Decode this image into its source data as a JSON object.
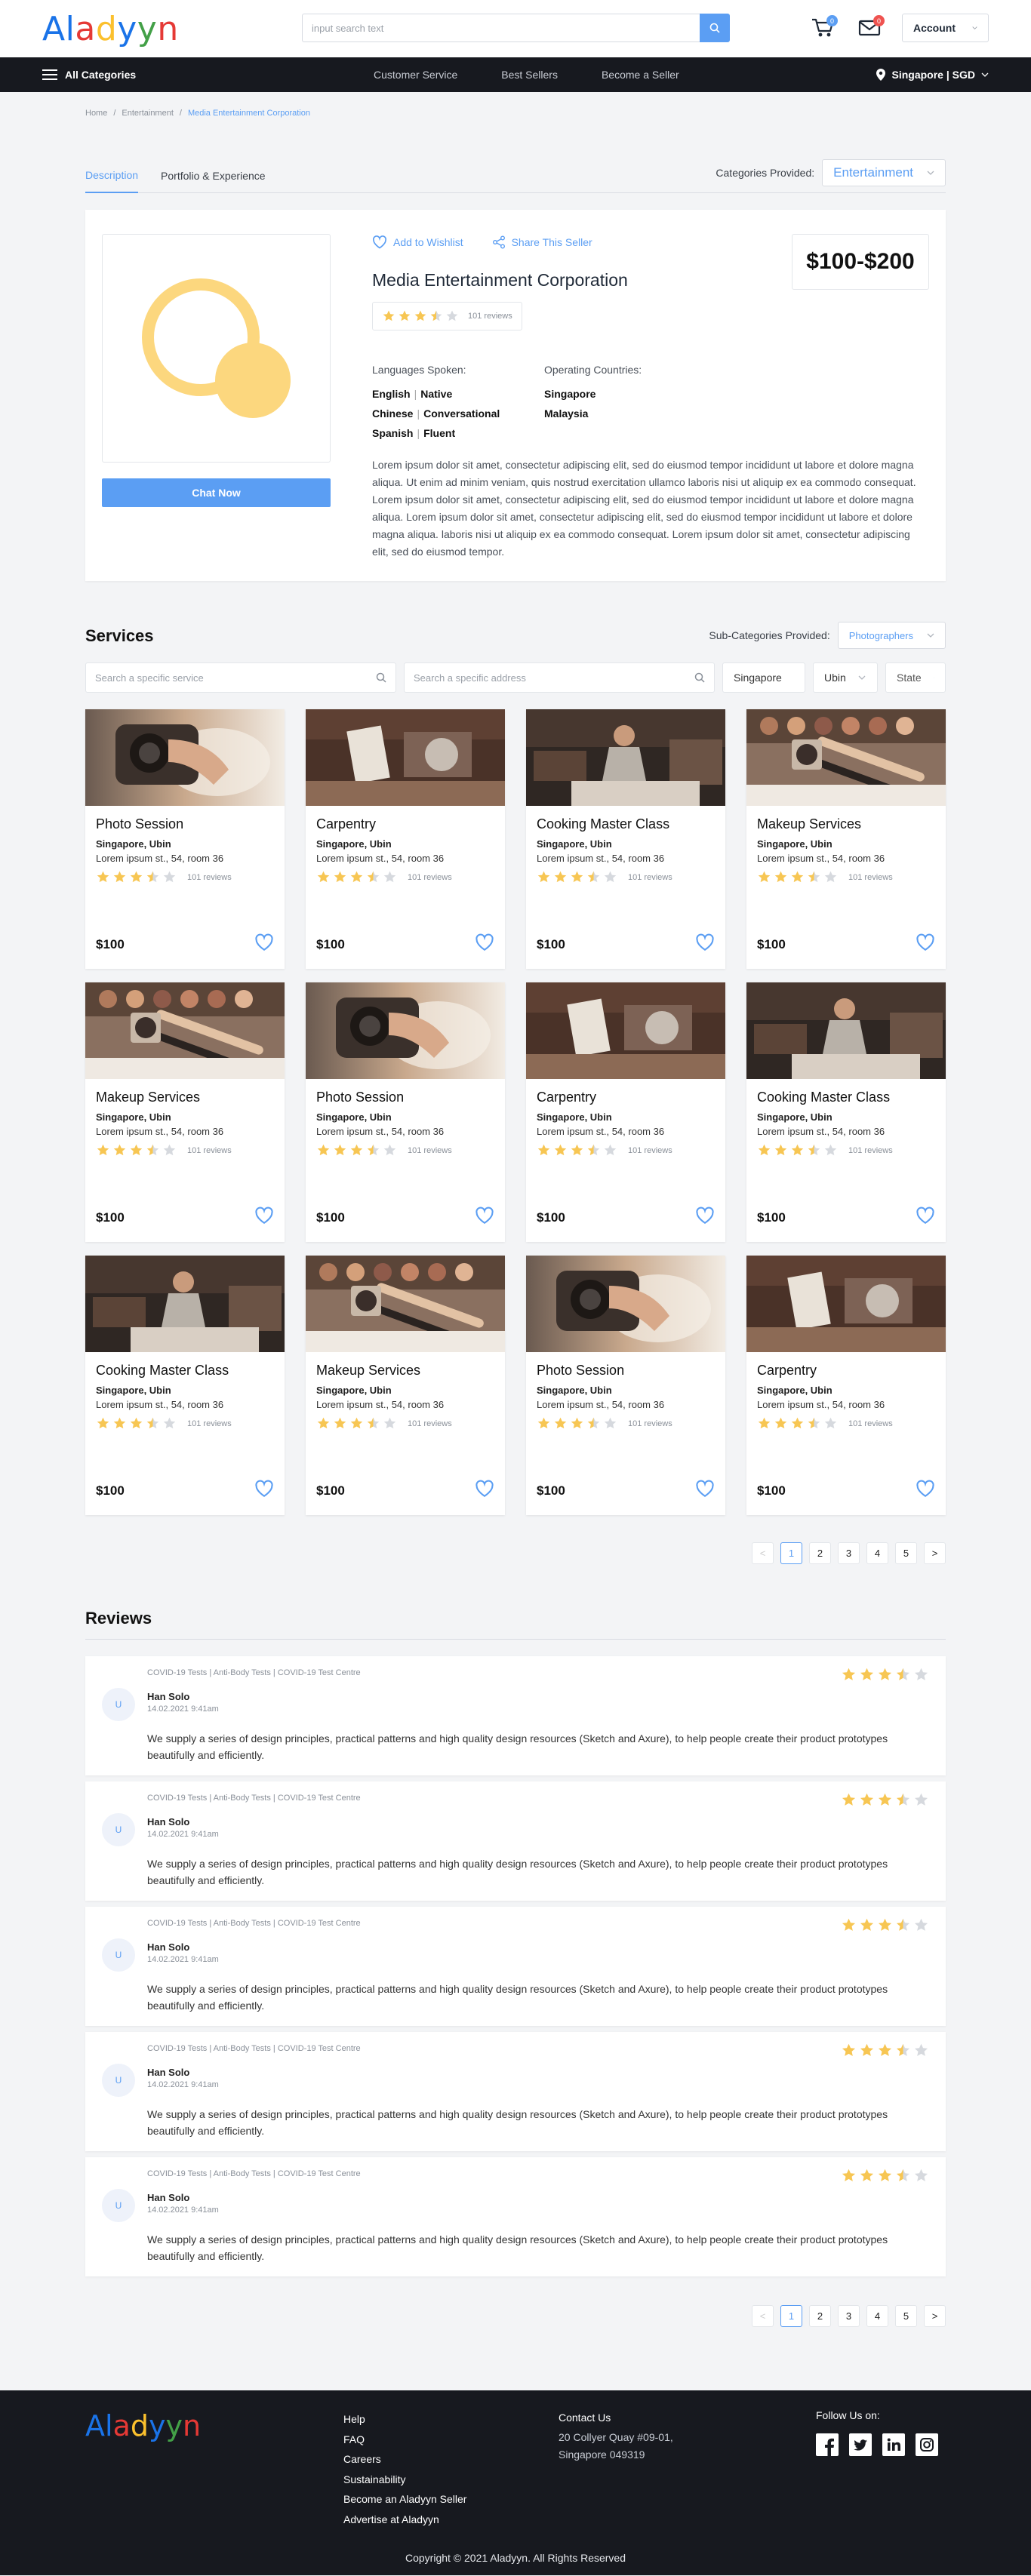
{
  "brand": {
    "letters": [
      {
        "ch": "A",
        "color": "#1a73e8"
      },
      {
        "ch": "l",
        "color": "#1a73e8"
      },
      {
        "ch": "a",
        "color": "#e53935"
      },
      {
        "ch": "d",
        "color": "#fbc02d"
      },
      {
        "ch": "y",
        "color": "#1a73e8"
      },
      {
        "ch": "y",
        "color": "#43a047"
      },
      {
        "ch": "n",
        "color": "#e53935"
      }
    ]
  },
  "header": {
    "search_placeholder": "input search text",
    "cart_count": "0",
    "mail_count": "0",
    "account_label": "Account"
  },
  "nav": {
    "all_categories": "All Categories",
    "links": [
      "Customer Service",
      "Best Sellers",
      "Become a Seller"
    ],
    "region": "Singapore | SGD"
  },
  "breadcrumb": [
    "Home",
    "/",
    "Entertainment",
    "/",
    "Media Entertainment Corporation"
  ],
  "tabs": [
    "Description",
    "Portfolio & Experience"
  ],
  "categories_provided": {
    "label": "Categories Provided:",
    "value": "Entertainment"
  },
  "seller": {
    "wishlist": "Add to Wishlist",
    "share": "Share This Seller",
    "name": "Media Entertainment Corporation",
    "rating": 3.5,
    "reviews": "101 reviews",
    "price": "$100-$200",
    "chat": "Chat Now",
    "languages_label": "Languages Spoken:",
    "languages": [
      {
        "lang": "English",
        "level": "Native"
      },
      {
        "lang": "Chinese",
        "level": "Conversational"
      },
      {
        "lang": "Spanish",
        "level": "Fluent"
      }
    ],
    "countries_label": "Operating Countries:",
    "countries": [
      "Singapore",
      "Malaysia"
    ],
    "description": "Lorem ipsum dolor sit amet, consectetur adipiscing elit, sed do eiusmod tempor incididunt ut labore et dolore magna aliqua. Ut enim ad minim veniam, quis nostrud exercitation ullamco laboris nisi ut aliquip ex ea commodo consequat. Lorem ipsum dolor sit amet, consectetur adipiscing elit, sed do eiusmod tempor incididunt ut labore et dolore magna aliqua.  Lorem ipsum dolor sit amet, consectetur adipiscing elit, sed do eiusmod tempor incididunt ut labore et dolore magna aliqua. laboris nisi ut aliquip ex ea commodo consequat. Lorem ipsum dolor sit amet, consectetur adipiscing elit, sed do eiusmod tempor."
  },
  "services": {
    "title": "Services",
    "subcat_label": "Sub-Categories Provided:",
    "subcat_value": "Photographers",
    "search_service_placeholder": "Search a specific service",
    "search_address_placeholder": "Search a specific address",
    "country": "Singapore",
    "area": "Ubin",
    "state": "State",
    "items": [
      {
        "title": "Photo Session",
        "img": "photo",
        "location": "Singapore, Ubin",
        "address": "Lorem ipsum st., 54, room 36",
        "rating": 3.5,
        "reviews": "101 reviews",
        "price": "$100"
      },
      {
        "title": "Carpentry",
        "img": "carpentry",
        "location": "Singapore, Ubin",
        "address": "Lorem ipsum st., 54, room 36",
        "rating": 3.5,
        "reviews": "101 reviews",
        "price": "$100"
      },
      {
        "title": "Cooking Master Class",
        "img": "cooking",
        "location": "Singapore, Ubin",
        "address": "Lorem ipsum st., 54, room 36",
        "rating": 3.5,
        "reviews": "101 reviews",
        "price": "$100"
      },
      {
        "title": "Makeup Services",
        "img": "makeup",
        "location": "Singapore, Ubin",
        "address": "Lorem ipsum st., 54, room 36",
        "rating": 3.5,
        "reviews": "101 reviews",
        "price": "$100"
      },
      {
        "title": "Makeup Services",
        "img": "makeup",
        "location": "Singapore, Ubin",
        "address": "Lorem ipsum st., 54, room 36",
        "rating": 3.5,
        "reviews": "101 reviews",
        "price": "$100"
      },
      {
        "title": "Photo Session",
        "img": "photo",
        "location": "Singapore, Ubin",
        "address": "Lorem ipsum st., 54, room 36",
        "rating": 3.5,
        "reviews": "101 reviews",
        "price": "$100"
      },
      {
        "title": "Carpentry",
        "img": "carpentry",
        "location": "Singapore, Ubin",
        "address": "Lorem ipsum st., 54, room 36",
        "rating": 3.5,
        "reviews": "101 reviews",
        "price": "$100"
      },
      {
        "title": "Cooking Master Class",
        "img": "cooking",
        "location": "Singapore, Ubin",
        "address": "Lorem ipsum st., 54, room 36",
        "rating": 3.5,
        "reviews": "101 reviews",
        "price": "$100"
      },
      {
        "title": "Cooking Master Class",
        "img": "cooking",
        "location": "Singapore, Ubin",
        "address": "Lorem ipsum st., 54, room 36",
        "rating": 3.5,
        "reviews": "101 reviews",
        "price": "$100"
      },
      {
        "title": "Makeup Services",
        "img": "makeup",
        "location": "Singapore, Ubin",
        "address": "Lorem ipsum st., 54, room 36",
        "rating": 3.5,
        "reviews": "101 reviews",
        "price": "$100"
      },
      {
        "title": "Photo Session",
        "img": "photo",
        "location": "Singapore, Ubin",
        "address": "Lorem ipsum st., 54, room 36",
        "rating": 3.5,
        "reviews": "101 reviews",
        "price": "$100"
      },
      {
        "title": "Carpentry",
        "img": "carpentry",
        "location": "Singapore, Ubin",
        "address": "Lorem ipsum st., 54, room 36",
        "rating": 3.5,
        "reviews": "101 reviews",
        "price": "$100"
      }
    ]
  },
  "pagination": {
    "prev": "<",
    "pages": [
      "1",
      "2",
      "3",
      "4",
      "5"
    ],
    "next": ">",
    "current": "1"
  },
  "reviews": {
    "title": "Reviews",
    "items": [
      {
        "initial": "U",
        "tags": "COVID-19 Tests | Anti-Body Tests | COVID-19 Test Centre",
        "name": "Han Solo",
        "date": "14.02.2021 9:41am",
        "rating": 3.5,
        "text": "We supply a series of design principles, practical patterns and high quality design resources (Sketch and Axure), to help people create their product prototypes beautifully and efficiently."
      },
      {
        "initial": "U",
        "tags": "COVID-19 Tests | Anti-Body Tests | COVID-19 Test Centre",
        "name": "Han Solo",
        "date": "14.02.2021 9:41am",
        "rating": 3.5,
        "text": "We supply a series of design principles, practical patterns and high quality design resources (Sketch and Axure), to help people create their product prototypes beautifully and efficiently."
      },
      {
        "initial": "U",
        "tags": "COVID-19 Tests | Anti-Body Tests | COVID-19 Test Centre",
        "name": "Han Solo",
        "date": "14.02.2021 9:41am",
        "rating": 3.5,
        "text": "We supply a series of design principles, practical patterns and high quality design resources (Sketch and Axure), to help people create their product prototypes beautifully and efficiently."
      },
      {
        "initial": "U",
        "tags": "COVID-19 Tests | Anti-Body Tests | COVID-19 Test Centre",
        "name": "Han Solo",
        "date": "14.02.2021 9:41am",
        "rating": 3.5,
        "text": "We supply a series of design principles, practical patterns and high quality design resources (Sketch and Axure), to help people create their product prototypes beautifully and efficiently."
      },
      {
        "initial": "U",
        "tags": "COVID-19 Tests | Anti-Body Tests | COVID-19 Test Centre",
        "name": "Han Solo",
        "date": "14.02.2021 9:41am",
        "rating": 3.5,
        "text": "We supply a series of design principles, practical patterns and high quality design resources (Sketch and Axure), to help people create their product prototypes beautifully and efficiently."
      }
    ]
  },
  "footer": {
    "links": [
      "Help",
      "FAQ",
      "Careers",
      "Sustainability",
      "Become an Aladyyn Seller",
      "Advertise at Aladyyn"
    ],
    "contact_title": "Contact Us",
    "address_line1": "20 Collyer Quay #09-01,",
    "address_line2": "Singapore 049319",
    "follow_title": "Follow Us on:",
    "social": [
      "facebook-icon",
      "twitter-icon",
      "linkedin-icon",
      "instagram-icon"
    ],
    "copyright": "Copyright © 2021 Aladyyn. All Rights Reserved"
  },
  "colors": {
    "accent": "#5b9ef3",
    "star": "#f7c653",
    "star_empty": "#d6d9de",
    "badge": "#5b9ef3",
    "mail_badge": "#ef5350",
    "dark": "#17191f"
  }
}
